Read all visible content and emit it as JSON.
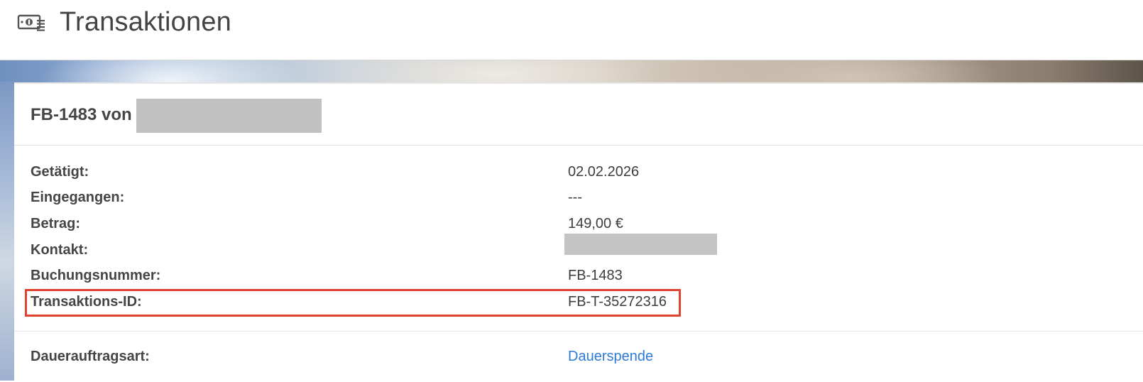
{
  "header": {
    "icon": "money-icon",
    "title": "Transaktionen"
  },
  "transaction": {
    "title": "FB-1483 von",
    "fields": {
      "getaetigt": {
        "label": "Getätigt:",
        "value": "02.02.2026"
      },
      "eingegangen": {
        "label": "Eingegangen:",
        "value": "---"
      },
      "betrag": {
        "label": "Betrag:",
        "value": "149,00 €"
      },
      "kontakt": {
        "label": "Kontakt:",
        "value": ""
      },
      "buchungsnummer": {
        "label": "Buchungsnummer:",
        "value": "FB-1483"
      },
      "transaktions_id": {
        "label": "Transaktions-ID:",
        "value": "FB-T-35272316"
      }
    },
    "dauerauftrag": {
      "label": "Dauerauftragsart:",
      "value": "Dauerspende"
    }
  },
  "colors": {
    "highlight": "#e0442e",
    "link": "#2f7ad6"
  }
}
